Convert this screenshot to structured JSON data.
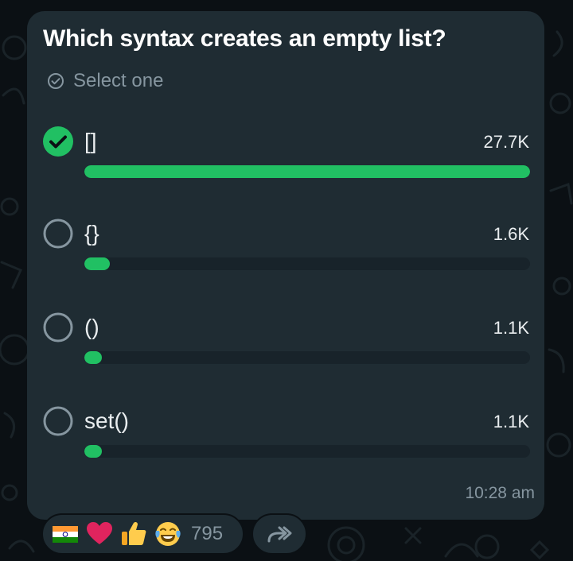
{
  "poll": {
    "question": "Which syntax creates an empty list?",
    "instruction": "Select one",
    "options": [
      {
        "label": "[]",
        "count": "27.7K",
        "share": 1.0,
        "selected": true
      },
      {
        "label": "{}",
        "count": "1.6K",
        "share": 0.058,
        "selected": false
      },
      {
        "label": "()",
        "count": "1.1K",
        "share": 0.04,
        "selected": false
      },
      {
        "label": "set()",
        "count": "1.1K",
        "share": 0.04,
        "selected": false
      }
    ],
    "time": "10:28 am"
  },
  "reactions": {
    "emojis": [
      "india-flag-icon",
      "red-heart-icon",
      "thumbs-up-icon",
      "tears-of-joy-icon"
    ],
    "count": "795"
  },
  "colors": {
    "background": "#0b1014",
    "bubble": "#1f2c33",
    "accent": "#21c063",
    "track": "#18232a",
    "muted_text": "#8696a0",
    "primary_text": "#ffffff"
  }
}
